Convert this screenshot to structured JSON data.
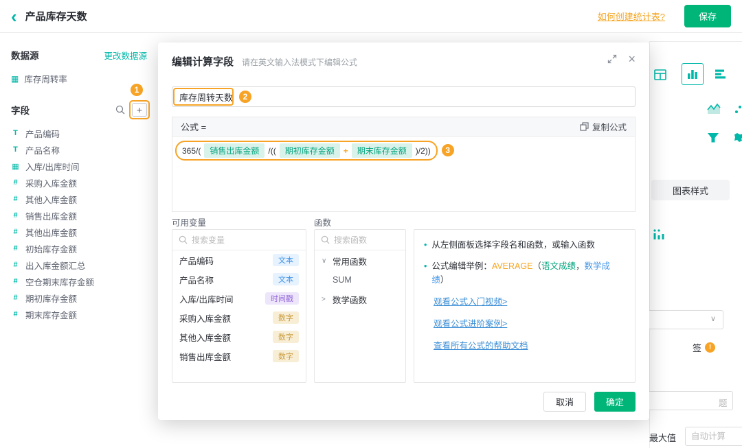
{
  "header": {
    "back_glyph": "‹",
    "title": "产品库存天数",
    "help_link": "如何创建统计表?",
    "save_label": "保存"
  },
  "sidebar": {
    "datasource_label": "数据源",
    "change_datasource_link": "更改数据源",
    "datasource_icon_glyph": "▦",
    "datasource_item": "库存周转率",
    "fields_label": "字段",
    "add_field_glyph": "+",
    "fields": [
      {
        "glyph": "T",
        "name": "产品编码"
      },
      {
        "glyph": "T",
        "name": "产品名称"
      },
      {
        "glyph": "▦",
        "name": "入库/出库时间"
      },
      {
        "glyph": "#",
        "name": "采购入库金额"
      },
      {
        "glyph": "#",
        "name": "其他入库金额"
      },
      {
        "glyph": "#",
        "name": "销售出库金额"
      },
      {
        "glyph": "#",
        "name": "其他出库金额"
      },
      {
        "glyph": "#",
        "name": "初始库存金额"
      },
      {
        "glyph": "#",
        "name": "出入库金额汇总"
      },
      {
        "glyph": "#",
        "name": "空仓期末库存金额"
      },
      {
        "glyph": "#",
        "name": "期初库存金额"
      },
      {
        "glyph": "#",
        "name": "期末库存金额"
      }
    ]
  },
  "annotations": {
    "step1": "1",
    "step2": "2",
    "step3": "3"
  },
  "modal": {
    "title": "编辑计算字段",
    "subtitle": "请在英文输入法模式下编辑公式",
    "close_glyph": "×",
    "field_name_value": "库存周转天数",
    "formula_label": "公式 =",
    "copy_formula_label": "复制公式",
    "formula": {
      "seg1": "365/(",
      "var1": "销售出库金额",
      "seg2": "/((",
      "var2": "期初库存金额",
      "op": "+",
      "var3": "期末库存金额",
      "seg3": ")/2))"
    },
    "variables": {
      "title": "可用变量",
      "search_placeholder": "搜索变量",
      "items": [
        {
          "name": "产品编码",
          "type": "文本"
        },
        {
          "name": "产品名称",
          "type": "文本"
        },
        {
          "name": "入库/出库时间",
          "type": "时间戳"
        },
        {
          "name": "采购入库金额",
          "type": "数字"
        },
        {
          "name": "其他入库金额",
          "type": "数字"
        },
        {
          "name": "销售出库金额",
          "type": "数字"
        }
      ]
    },
    "functions": {
      "title": "函数",
      "search_placeholder": "搜索函数",
      "caret_open": "∨",
      "caret_closed": ">",
      "group_common": "常用函数",
      "fn_sum": "SUM",
      "group_math": "数学函数"
    },
    "help": {
      "bullet_glyph": "•",
      "bullet1": "从左侧面板选择字段名和函数，或输入函数",
      "example_prefix": "公式编辑举例：",
      "example_fn": "AVERAGE",
      "example_open": "（",
      "example_arg1": "语文成绩",
      "example_comma": "，",
      "example_arg2": "数学成绩",
      "example_close": "）",
      "link_video": "观看公式入门视频>",
      "link_advanced": "观看公式进阶案例>",
      "link_docs": "查看所有公式的帮助文档"
    },
    "cancel_label": "取消",
    "confirm_label": "确定"
  },
  "right_panel": {
    "chart_style_tab": "图表样式",
    "dropdown_glyph": "∨",
    "label_partial": "签",
    "warning_glyph": "!",
    "title_partial": "题",
    "max_value_label": "最大值",
    "max_value_placeholder": "自动计算"
  },
  "colors": {
    "primary_green": "#00b578",
    "teal": "#00b8a9",
    "annotation_orange": "#f7a325",
    "link_blue": "#3d8fd6"
  }
}
